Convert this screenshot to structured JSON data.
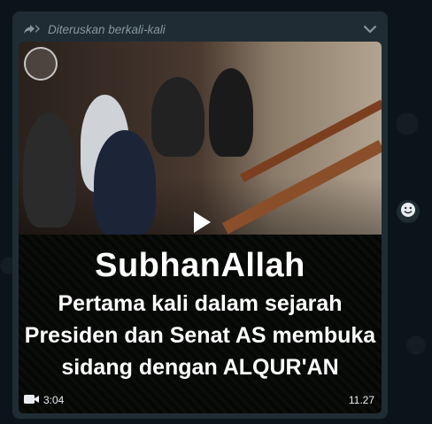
{
  "message": {
    "forwarded_label": "Diteruskan berkali-kali",
    "icons": {
      "forward": "forwarded-arrows-icon",
      "menu": "chevron-down-icon",
      "play": "play-icon",
      "video": "video-camera-icon",
      "reaction": "emoji-smiley-icon"
    },
    "video": {
      "caption_title": "SubhanAllah",
      "caption_line1": "Pertama kali dalam sejarah",
      "caption_line2": "Presiden dan Senat AS membuka",
      "caption_line3": "sidang dengan ALQUR'AN",
      "duration": "3:04",
      "timestamp": "11.27"
    }
  },
  "colors": {
    "chat_background": "#0b141a",
    "bubble_background": "#202c33",
    "meta_text": "#8696a0"
  }
}
